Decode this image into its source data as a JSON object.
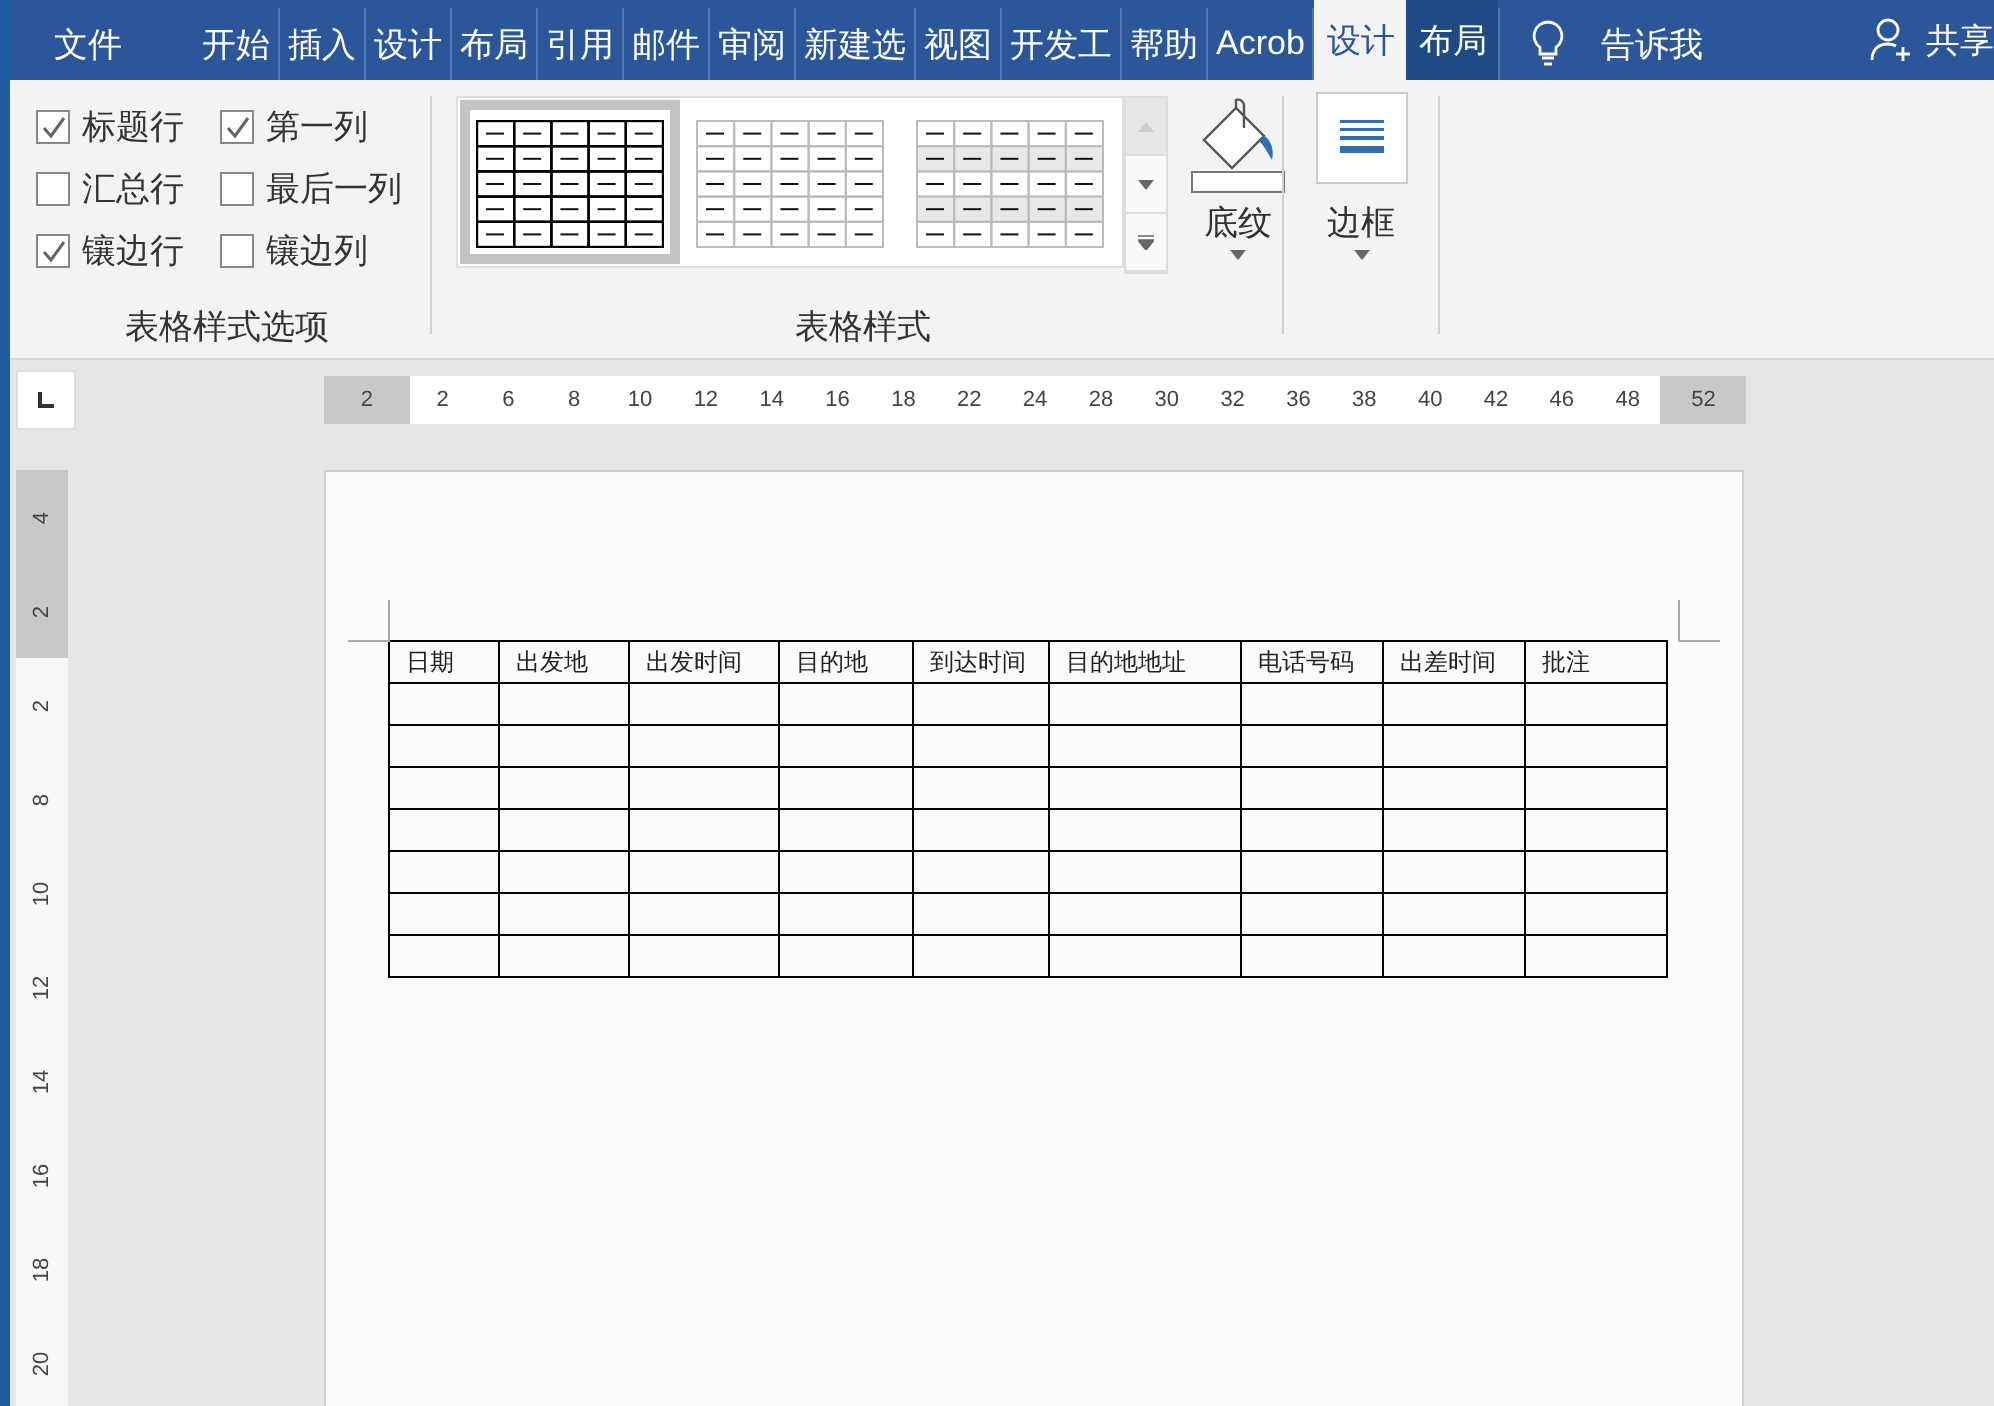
{
  "tabs": [
    {
      "label": "文件",
      "kind": "file",
      "selected": false
    },
    {
      "label": "开始",
      "kind": "normal",
      "selected": false
    },
    {
      "label": "插入",
      "kind": "normal",
      "selected": false
    },
    {
      "label": "设计",
      "kind": "normal",
      "selected": false
    },
    {
      "label": "布局",
      "kind": "normal",
      "selected": false
    },
    {
      "label": "引用",
      "kind": "normal",
      "selected": false
    },
    {
      "label": "邮件",
      "kind": "normal",
      "selected": false
    },
    {
      "label": "审阅",
      "kind": "normal",
      "selected": false
    },
    {
      "label": "新建选",
      "kind": "normal",
      "selected": false
    },
    {
      "label": "视图",
      "kind": "normal",
      "selected": false
    },
    {
      "label": "开发工",
      "kind": "normal",
      "selected": false
    },
    {
      "label": "帮助",
      "kind": "normal",
      "selected": false
    },
    {
      "label": "Acrob",
      "kind": "normal",
      "selected": false
    },
    {
      "label": "设计",
      "kind": "context",
      "selected": true
    },
    {
      "label": "布局",
      "kind": "context",
      "selected": false
    }
  ],
  "tell_me": "告诉我",
  "share": "共享",
  "style_options": {
    "label": "表格样式选项",
    "items": [
      {
        "label": "标题行",
        "checked": true
      },
      {
        "label": "第一列",
        "checked": true
      },
      {
        "label": "汇总行",
        "checked": false
      },
      {
        "label": "最后一列",
        "checked": false
      },
      {
        "label": "镶边行",
        "checked": true
      },
      {
        "label": "镶边列",
        "checked": false
      }
    ]
  },
  "table_styles": {
    "label": "表格样式",
    "styles": [
      {
        "kind": "grid",
        "selected": true
      },
      {
        "kind": "light",
        "selected": false
      },
      {
        "kind": "banded",
        "selected": false
      }
    ]
  },
  "shading_button": "底纹",
  "borders_button": "边框",
  "horizontal_ruler": [
    {
      "label": "2",
      "shaded": true
    },
    {
      "label": "2",
      "shaded": false
    },
    {
      "label": "6",
      "shaded": false
    },
    {
      "label": "8",
      "shaded": false
    },
    {
      "label": "10",
      "shaded": false
    },
    {
      "label": "12",
      "shaded": false
    },
    {
      "label": "14",
      "shaded": false
    },
    {
      "label": "16",
      "shaded": false
    },
    {
      "label": "18",
      "shaded": false
    },
    {
      "label": "22",
      "shaded": false
    },
    {
      "label": "24",
      "shaded": false
    },
    {
      "label": "28",
      "shaded": false
    },
    {
      "label": "30",
      "shaded": false
    },
    {
      "label": "32",
      "shaded": false
    },
    {
      "label": "36",
      "shaded": false
    },
    {
      "label": "38",
      "shaded": false
    },
    {
      "label": "40",
      "shaded": false
    },
    {
      "label": "42",
      "shaded": false
    },
    {
      "label": "46",
      "shaded": false
    },
    {
      "label": "48",
      "shaded": false
    },
    {
      "label": "52",
      "shaded": true
    }
  ],
  "vertical_ruler": [
    {
      "label": "4",
      "shaded": true
    },
    {
      "label": "2",
      "shaded": true
    },
    {
      "label": "2",
      "shaded": false
    },
    {
      "label": "8",
      "shaded": false
    },
    {
      "label": "10",
      "shaded": false
    },
    {
      "label": "12",
      "shaded": false
    },
    {
      "label": "14",
      "shaded": false
    },
    {
      "label": "16",
      "shaded": false
    },
    {
      "label": "18",
      "shaded": false
    },
    {
      "label": "20",
      "shaded": false
    }
  ],
  "table": {
    "columns": [
      "日期",
      "出发地",
      "出发时间",
      "目的地",
      "到达时间",
      "目的地地址",
      "电话号码",
      "出差时间",
      "批注"
    ],
    "rows": [
      {
        "kind": "blank"
      },
      {
        "kind": "blank"
      },
      {
        "kind": "blank"
      },
      {
        "kind": "blank"
      },
      {
        "kind": "blank"
      },
      {
        "kind": "blank"
      },
      {
        "kind": "blank"
      }
    ]
  }
}
